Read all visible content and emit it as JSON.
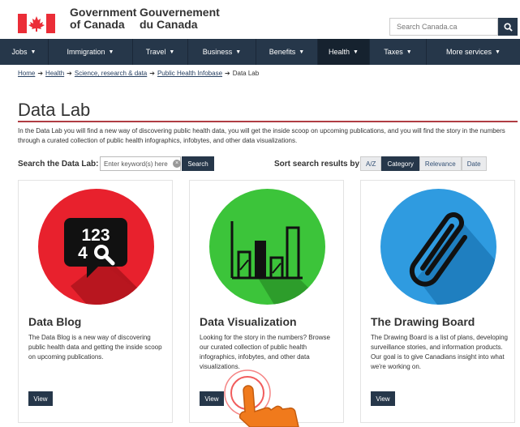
{
  "header": {
    "gov_en": "Government of Canada",
    "gov_fr": "Gouvernement du Canada",
    "search_placeholder": "Search Canada.ca",
    "search_icon": "search-icon"
  },
  "nav": {
    "items": [
      {
        "label": "Jobs"
      },
      {
        "label": "Immigration"
      },
      {
        "label": "Travel"
      },
      {
        "label": "Business"
      },
      {
        "label": "Benefits"
      },
      {
        "label": "Health"
      },
      {
        "label": "Taxes"
      },
      {
        "label": "More services"
      }
    ],
    "active": "Health"
  },
  "breadcrumb": {
    "items": [
      "Home",
      "Health",
      "Science, research & data",
      "Public Health Infobase"
    ],
    "current": "Data Lab"
  },
  "page": {
    "title": "Data Lab",
    "intro": "In the Data Lab you will find a new way of discovering public health data, you will get the inside scoop on upcoming publications, and you will find the story in the numbers through a curated collection of public health infographics, infobytes, and other data visualizations."
  },
  "search": {
    "label": "Search the Data Lab:",
    "placeholder": "Enter keyword(s) here",
    "button": "Search"
  },
  "sort": {
    "label": "Sort search results by:",
    "options": [
      "A/Z",
      "Category",
      "Relevance",
      "Date"
    ],
    "active": "Category"
  },
  "cards": [
    {
      "title": "Data Blog",
      "description": "The Data Blog is a new way of discovering public health data and getting the inside scoop on upcoming publications.",
      "button": "View",
      "image_icon": "numbers-magnifier-icon",
      "image_text_top": "123",
      "image_text_bottom": "4",
      "color": "#e8212d"
    },
    {
      "title": "Data Visualization",
      "description": "Looking for the story in the numbers? Browse our curated collection of public health infographics, infobytes, and other data visualizations.",
      "button": "View",
      "image_icon": "bar-chart-icon",
      "color": "#3cc43a"
    },
    {
      "title": "The Drawing Board",
      "description": "The Drawing Board is a list of plans, developing surveillance stories, and information products. Our goal is to give Canadians insight into what we're working on.",
      "button": "View",
      "image_icon": "paperclip-icon",
      "color": "#2f9be0"
    }
  ],
  "colors": {
    "nav_bg": "#26374a",
    "title_rule": "#af3c43",
    "flag_red": "#eb2d37",
    "cursor_orange": "#f07a1c"
  }
}
